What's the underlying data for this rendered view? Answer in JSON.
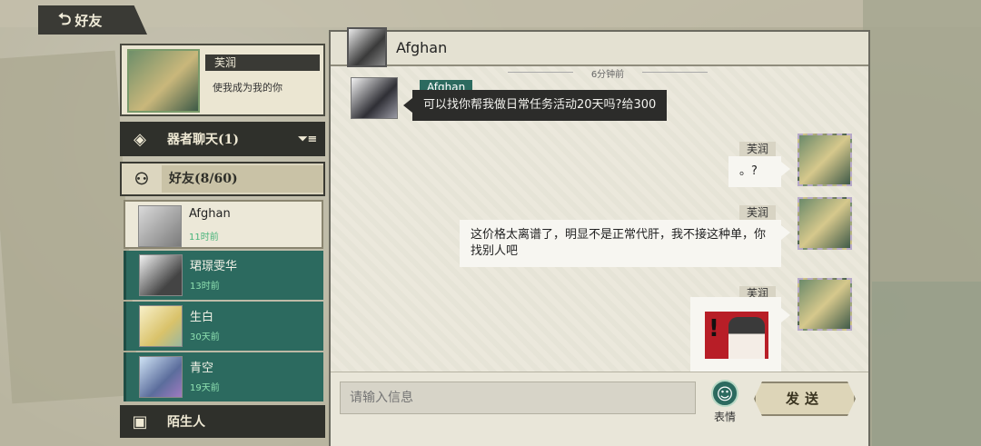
{
  "nav": {
    "back_label": "好友",
    "back_icon": "back-arrow-icon"
  },
  "profile": {
    "name": "芙润",
    "signature": "使我成为我的你"
  },
  "sections": {
    "chat": {
      "label": "器者聊天(1)",
      "icon": "diamond-chat-icon",
      "filter_icon": "filter-icon"
    },
    "friends": {
      "label": "好友(8/60)",
      "icon": "friends-icon"
    },
    "strangers": {
      "label": "陌生人",
      "icon": "stranger-icon"
    }
  },
  "friends": [
    {
      "name": "Afghan",
      "time": "11时前",
      "selected": true
    },
    {
      "name": "珺璟雯华",
      "time": "13时前",
      "selected": false
    },
    {
      "name": "生白",
      "time": "30天前",
      "selected": false
    },
    {
      "name": "青空",
      "time": "19天前",
      "selected": false
    }
  ],
  "chat": {
    "header_name": "Afghan",
    "timestamp": "6分钟前",
    "messages": [
      {
        "from": "Afghan",
        "text": "可以找你帮我做日常任务活动20天吗?给300"
      },
      {
        "from": "芙润",
        "text": "。?"
      },
      {
        "from": "芙润",
        "text": "这价格太离谱了，明显不是正常代肝，我不接这种单，你找别人吧"
      },
      {
        "from": "芙润",
        "text": ""
      }
    ]
  },
  "input": {
    "placeholder": "请输入信息",
    "emoji_label": "表情",
    "send_label": "发送"
  },
  "colors": {
    "accent": "#2c6a5f",
    "dark": "#2c2c2a",
    "panel": "#ebe8dc"
  }
}
